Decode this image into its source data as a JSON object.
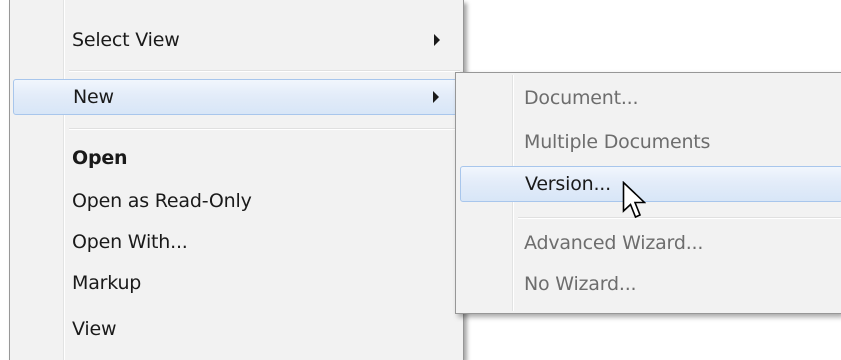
{
  "menu": {
    "items": [
      {
        "label": "Select View",
        "has_submenu": true
      },
      {
        "label": "New",
        "has_submenu": true,
        "highlighted": true
      },
      {
        "label": "Open",
        "bold": true
      },
      {
        "label": "Open as Read-Only"
      },
      {
        "label": "Open With..."
      },
      {
        "label": "Markup"
      },
      {
        "label": "View"
      }
    ]
  },
  "submenu": {
    "items": [
      {
        "label": "Document...",
        "enabled": false
      },
      {
        "label": "Multiple Documents",
        "enabled": false
      },
      {
        "label": "Version...",
        "enabled": true,
        "highlighted": true
      },
      {
        "label": "Advanced Wizard...",
        "enabled": false
      },
      {
        "label": "No Wizard...",
        "enabled": false
      }
    ]
  },
  "icons": {
    "submenu_arrow": "chevron-right-icon",
    "cursor": "mouse-pointer-icon"
  },
  "colors": {
    "menu_background": "#f2f2f2",
    "highlight_border": "#a8c6ec",
    "highlight_fill": "#dfe9f7",
    "disabled_text": "#6d6d6d",
    "text": "#1a1a1a"
  }
}
